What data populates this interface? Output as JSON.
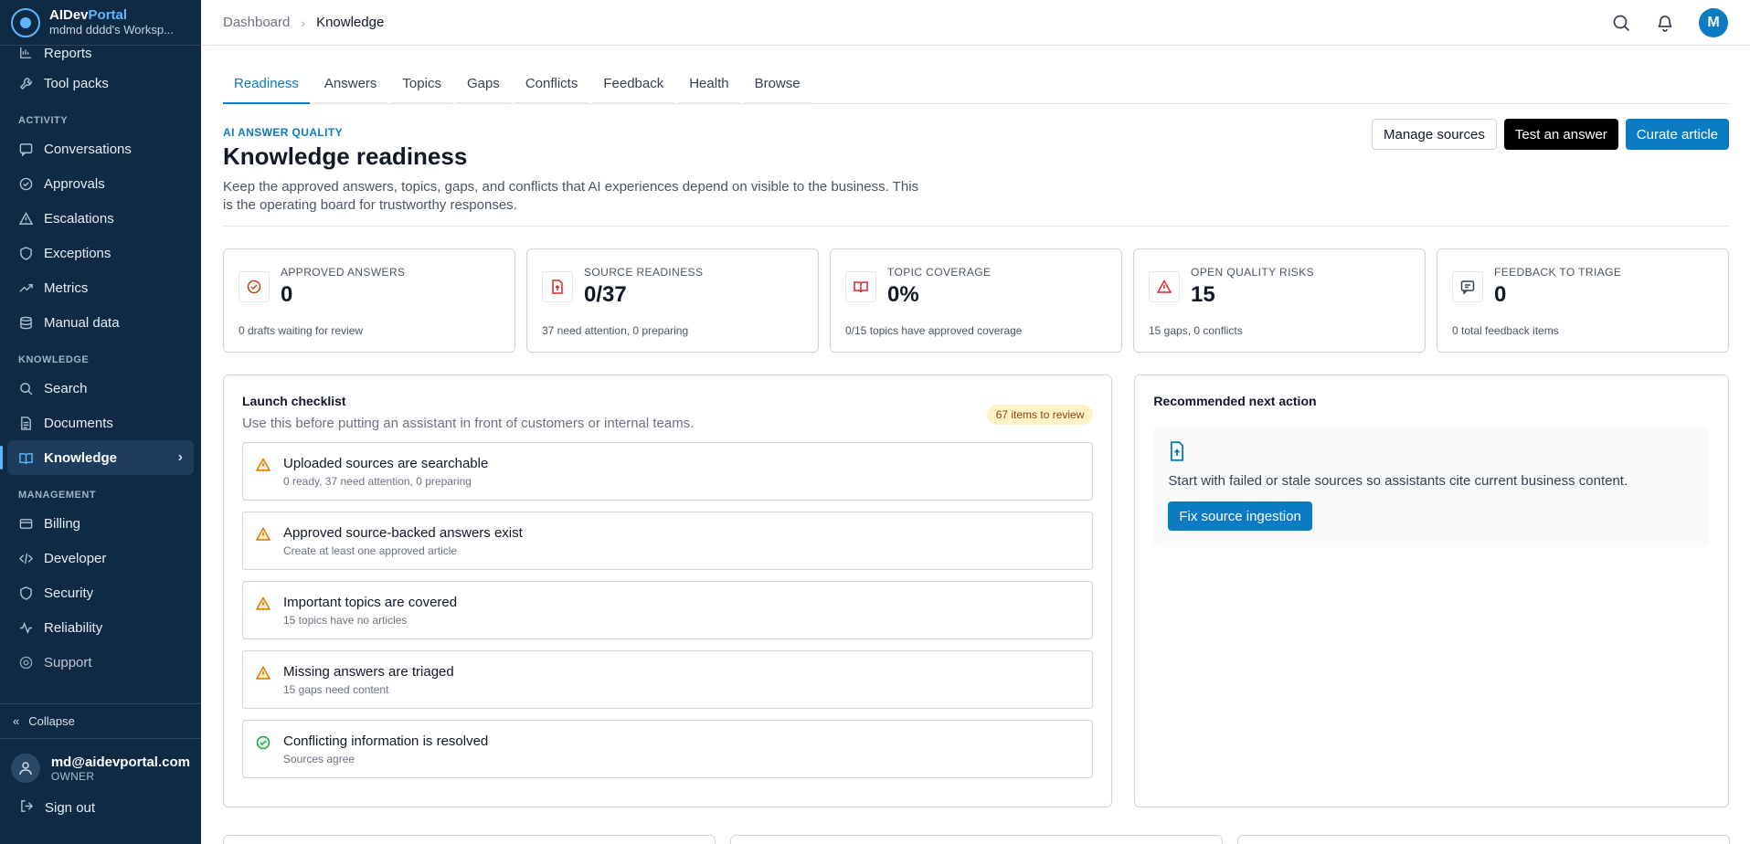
{
  "brand": {
    "name_main": "AIDev",
    "name_accent": "Portal",
    "workspace": "mdmd dddd's Worksp..."
  },
  "sidebar": {
    "items_top": [
      {
        "label": "Reports",
        "icon": "chart-icon"
      },
      {
        "label": "Tool packs",
        "icon": "wrench-icon"
      }
    ],
    "sections": {
      "activity": "ACTIVITY",
      "knowledge": "KNOWLEDGE",
      "management": "MANAGEMENT"
    },
    "activity_items": [
      {
        "label": "Conversations",
        "icon": "chat-icon"
      },
      {
        "label": "Approvals",
        "icon": "check-circle-icon"
      },
      {
        "label": "Escalations",
        "icon": "warning-icon"
      },
      {
        "label": "Exceptions",
        "icon": "shield-icon"
      },
      {
        "label": "Metrics",
        "icon": "trend-icon"
      },
      {
        "label": "Manual data",
        "icon": "database-icon"
      }
    ],
    "knowledge_items": [
      {
        "label": "Search",
        "icon": "search-icon"
      },
      {
        "label": "Documents",
        "icon": "document-icon"
      },
      {
        "label": "Knowledge",
        "icon": "book-icon"
      }
    ],
    "management_items": [
      {
        "label": "Billing",
        "icon": "card-icon"
      },
      {
        "label": "Developer",
        "icon": "code-icon"
      },
      {
        "label": "Security",
        "icon": "shield-icon"
      },
      {
        "label": "Reliability",
        "icon": "pulse-icon"
      },
      {
        "label": "Support",
        "icon": "support-icon"
      }
    ],
    "collapse_label": "Collapse",
    "user": {
      "email": "md@aidevportal.com",
      "role": "OWNER"
    },
    "signout_label": "Sign out"
  },
  "topbar": {
    "breadcrumb_root": "Dashboard",
    "breadcrumb_current": "Knowledge",
    "avatar_initial": "M"
  },
  "tabs": [
    "Readiness",
    "Answers",
    "Topics",
    "Gaps",
    "Conflicts",
    "Feedback",
    "Health",
    "Browse"
  ],
  "header": {
    "eyebrow": "AI ANSWER QUALITY",
    "title": "Knowledge readiness",
    "description": "Keep the approved answers, topics, gaps, and conflicts that AI experiences depend on visible to the business. This is the operating board for trustworthy responses.",
    "actions": {
      "manage": "Manage sources",
      "test": "Test an answer",
      "curate": "Curate article"
    }
  },
  "stats": [
    {
      "label": "APPROVED ANSWERS",
      "value": "0",
      "note": "0 drafts waiting for review",
      "icon": "check-circle-icon",
      "color": "#c2410c"
    },
    {
      "label": "SOURCE READINESS",
      "value": "0/37",
      "note": "37 need attention, 0 preparing",
      "icon": "file-icon",
      "color": "#dc2626"
    },
    {
      "label": "TOPIC COVERAGE",
      "value": "0%",
      "note": "0/15 topics have approved coverage",
      "icon": "book-icon",
      "color": "#dc2626"
    },
    {
      "label": "OPEN QUALITY RISKS",
      "value": "15",
      "note": "15 gaps, 0 conflicts",
      "icon": "warning-icon",
      "color": "#dc2626"
    },
    {
      "label": "FEEDBACK TO TRIAGE",
      "value": "0",
      "note": "0 total feedback items",
      "icon": "message-icon",
      "color": "#374151"
    }
  ],
  "checklist": {
    "title": "Launch checklist",
    "subtitle": "Use this before putting an assistant in front of customers or internal teams.",
    "badge": "67 items to review",
    "items": [
      {
        "title": "Uploaded sources are searchable",
        "sub": "0 ready, 37 need attention, 0 preparing",
        "status": "warning"
      },
      {
        "title": "Approved source-backed answers exist",
        "sub": "Create at least one approved article",
        "status": "warning"
      },
      {
        "title": "Important topics are covered",
        "sub": "15 topics have no articles",
        "status": "warning"
      },
      {
        "title": "Missing answers are triaged",
        "sub": "15 gaps need content",
        "status": "warning"
      },
      {
        "title": "Conflicting information is resolved",
        "sub": "Sources agree",
        "status": "ok"
      }
    ]
  },
  "recommendation": {
    "title": "Recommended next action",
    "text": "Start with failed or stale sources so assistants cite current business content.",
    "button": "Fix source ingestion"
  },
  "colors": {
    "sidebar": "#0f2a44",
    "accent": "#0b7bc4",
    "warning": "#f59e0b",
    "ok": "#16a34a"
  }
}
